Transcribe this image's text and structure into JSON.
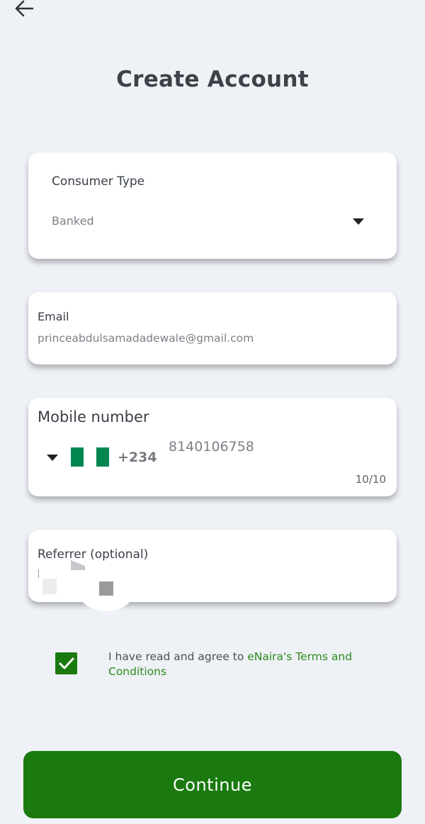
{
  "header": {
    "title": "Create Account",
    "back_icon": "arrow-left-icon"
  },
  "consumer_type": {
    "label": "Consumer Type",
    "value": "Banked",
    "dropdown_icon": "caret-down-icon"
  },
  "email": {
    "label": "Email",
    "value": "princeabdulsamadadewale@gmail.com"
  },
  "mobile": {
    "label": "Mobile number",
    "country_flag": "nigeria-flag-icon",
    "dial_code": "+234",
    "value": "8140106758",
    "char_count": "10/10"
  },
  "referrer": {
    "label": "Referrer (optional)",
    "value": ""
  },
  "agreement": {
    "checked": true,
    "text": "I have read and agree to ",
    "link_text": "eNaira's Terms and Conditions"
  },
  "footer": {
    "continue_label": "Continue"
  },
  "colors": {
    "primary": "#1a7a10",
    "background": "#eef1f6",
    "link": "#2c8b1a",
    "flag_green": "#008751"
  }
}
